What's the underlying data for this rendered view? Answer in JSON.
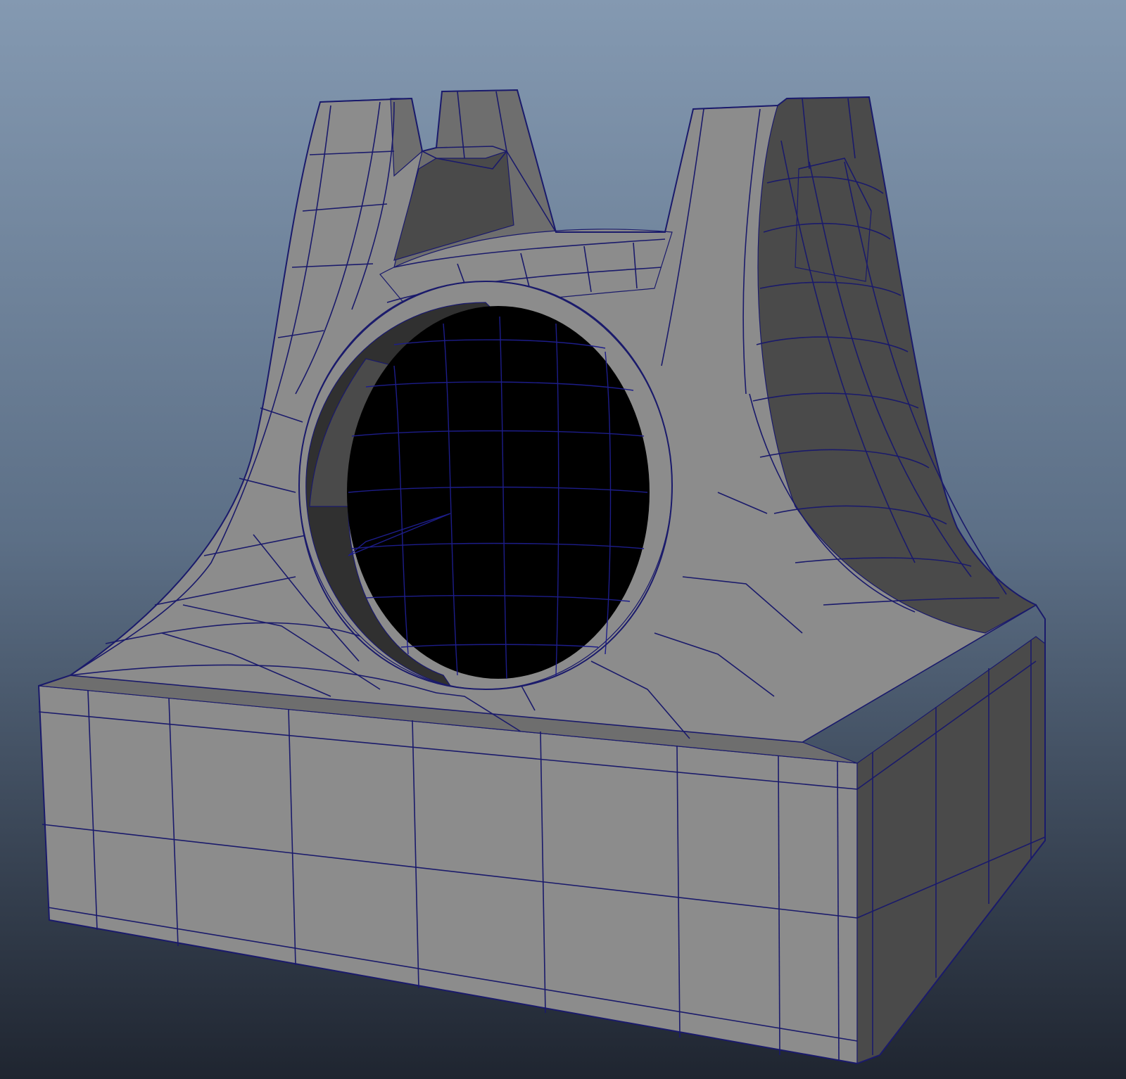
{
  "viewport": {
    "background_top": "#8499b1",
    "background_mid": "#5c6f86",
    "background_bottom": "#1f2530"
  },
  "model": {
    "shading": "smooth-shaded-with-wireframe",
    "face_light": "#8c8c8c",
    "face_mid": "#6e6e6e",
    "face_dark": "#4a4a4a",
    "face_darker": "#303030",
    "hole_color": "#000000",
    "wire_color": "#1a1a6b",
    "inner_wire_color": "#1d1d8a"
  }
}
